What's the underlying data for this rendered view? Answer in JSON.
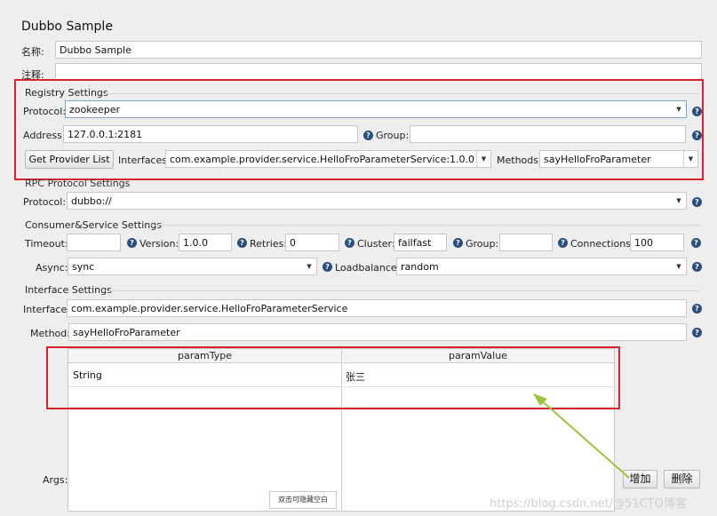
{
  "title": "Dubbo Sample",
  "name_label": "名称:",
  "name_value": "Dubbo Sample",
  "comment_label": "注释:",
  "comment_value": "",
  "registry": {
    "section": "Registry Settings",
    "protocol_label": "Protocol:",
    "protocol_value": "zookeeper",
    "address_label": "Address:",
    "address_value": "127.0.0.1:2181",
    "group_label": "Group:",
    "group_value": "",
    "get_provider_button": "Get Provider List",
    "interfaces_label": "Interfaces:",
    "interfaces_value": "com.example.provider.service.HelloFroParameterService:1.0.0",
    "methods_label": "Methods:",
    "methods_value": "sayHelloFroParameter"
  },
  "rpc": {
    "section": "RPC Protocol Settings",
    "protocol_label": "Protocol:",
    "protocol_value": "dubbo://"
  },
  "consumer": {
    "section": "Consumer&Service Settings",
    "timeout_label": "Timeout:",
    "timeout_value": "",
    "version_label": "Version:",
    "version_value": "1.0.0",
    "retries_label": "Retries:",
    "retries_value": "0",
    "cluster_label": "Cluster:",
    "cluster_value": "failfast",
    "group_label": "Group:",
    "group_value": "",
    "connections_label": "Connections:",
    "connections_value": "100",
    "async_label": "Async:",
    "async_value": "sync",
    "loadbalance_label": "Loadbalance:",
    "loadbalance_value": "random"
  },
  "interface": {
    "section": "Interface Settings",
    "interface_label": "Interface:",
    "interface_value": "com.example.provider.service.HelloFroParameterService",
    "method_label": "Method:",
    "method_value": "sayHelloFroParameter"
  },
  "args": {
    "label": "Args:",
    "columns": [
      "paramType",
      "paramValue"
    ],
    "rows": [
      [
        "String",
        "张三"
      ]
    ],
    "add_button": "增加",
    "delete_button": "删除",
    "tooltip": "双击可隐藏空白"
  },
  "watermark": "https://blog.csdn.net/@51CTO博客",
  "help_icon_glyph": "?",
  "colors": {
    "highlight_box": "#d9242f",
    "annotation_arrow": "#9bc43c",
    "help_icon": "#2a4f7c"
  }
}
